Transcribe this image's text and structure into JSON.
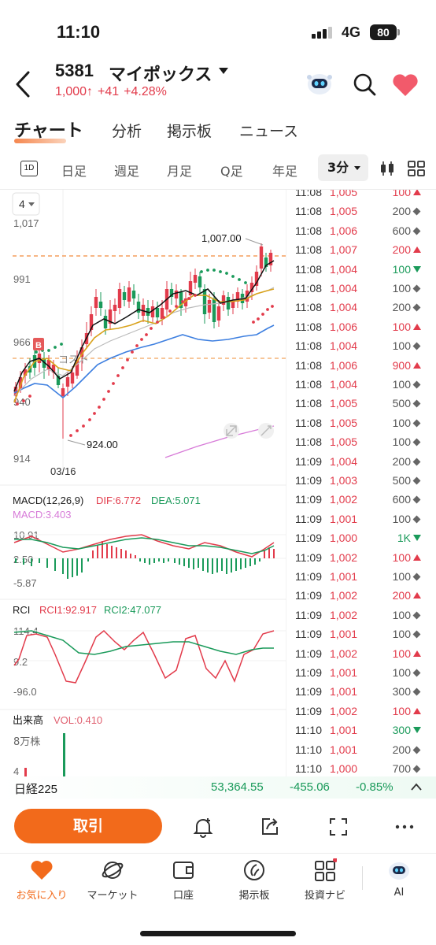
{
  "status_bar": {
    "time": "11:10",
    "network": "4G",
    "battery": "80"
  },
  "header": {
    "stock_code": "5381",
    "stock_name": "マイポックス",
    "price": "1,000",
    "arrow": "↑",
    "change": "+41",
    "change_pct": "+4.28%",
    "icons": [
      "back-icon",
      "ai-robot-icon",
      "search-icon",
      "heart-icon"
    ]
  },
  "tabs": [
    {
      "label": "チャート",
      "active": true
    },
    {
      "label": "分析"
    },
    {
      "label": "掲示板"
    },
    {
      "label": "ニュース"
    }
  ],
  "periods": {
    "icon_1d": "1D",
    "items": [
      "日足",
      "週足",
      "月足",
      "Q足",
      "年足"
    ],
    "active": "3分"
  },
  "chart": {
    "layers_dropdown": "4",
    "price_axis": [
      "1,017",
      "991",
      "966",
      "940",
      "914"
    ],
    "date_label": "03/16",
    "high_label": "1,007.00",
    "low_label": "924.00",
    "buy_marker": "B",
    "cost_label": "コスト",
    "macd": {
      "title": "MACD(12,26,9)",
      "dif": "DIF:6.772",
      "dea": "DEA:5.071",
      "macd": "MACD:3.403",
      "axis": [
        "10.91",
        "2.50",
        "-5.87"
      ]
    },
    "rci": {
      "title": "RCI",
      "rci1": "RCI1:92.917",
      "rci2": "RCI2:47.077",
      "axis": [
        "114.4",
        "9.2",
        "-96.0"
      ]
    },
    "volume": {
      "title": "出来高",
      "vol": "VOL:0.410",
      "axis": [
        "8万株",
        "4"
      ]
    },
    "colors": {
      "up": "#e23b4b",
      "down": "#1a9a5a",
      "ma_short": "#111111",
      "ma_mid": "#d9a21b",
      "ma_long": "#3d7fe0",
      "sar": "#e23b4b",
      "cost_line": "#f28a3c"
    }
  },
  "ticks": [
    {
      "time": "11:08",
      "price": "1,005",
      "vol": "100",
      "dir": "up"
    },
    {
      "time": "11:08",
      "price": "1,005",
      "vol": "200",
      "dir": "flat"
    },
    {
      "time": "11:08",
      "price": "1,006",
      "vol": "600",
      "dir": "flat"
    },
    {
      "time": "11:08",
      "price": "1,007",
      "vol": "200",
      "dir": "up"
    },
    {
      "time": "11:08",
      "price": "1,004",
      "vol": "100",
      "dir": "down"
    },
    {
      "time": "11:08",
      "price": "1,004",
      "vol": "100",
      "dir": "flat"
    },
    {
      "time": "11:08",
      "price": "1,004",
      "vol": "200",
      "dir": "flat"
    },
    {
      "time": "11:08",
      "price": "1,006",
      "vol": "100",
      "dir": "up"
    },
    {
      "time": "11:08",
      "price": "1,004",
      "vol": "100",
      "dir": "flat"
    },
    {
      "time": "11:08",
      "price": "1,006",
      "vol": "900",
      "dir": "up"
    },
    {
      "time": "11:08",
      "price": "1,004",
      "vol": "100",
      "dir": "flat"
    },
    {
      "time": "11:08",
      "price": "1,005",
      "vol": "500",
      "dir": "flat"
    },
    {
      "time": "11:08",
      "price": "1,005",
      "vol": "100",
      "dir": "flat"
    },
    {
      "time": "11:08",
      "price": "1,005",
      "vol": "100",
      "dir": "flat"
    },
    {
      "time": "11:09",
      "price": "1,004",
      "vol": "200",
      "dir": "flat"
    },
    {
      "time": "11:09",
      "price": "1,003",
      "vol": "500",
      "dir": "flat"
    },
    {
      "time": "11:09",
      "price": "1,002",
      "vol": "600",
      "dir": "flat"
    },
    {
      "time": "11:09",
      "price": "1,001",
      "vol": "100",
      "dir": "flat"
    },
    {
      "time": "11:09",
      "price": "1,000",
      "vol": "1K",
      "dir": "down"
    },
    {
      "time": "11:09",
      "price": "1,002",
      "vol": "100",
      "dir": "up"
    },
    {
      "time": "11:09",
      "price": "1,001",
      "vol": "100",
      "dir": "flat"
    },
    {
      "time": "11:09",
      "price": "1,002",
      "vol": "200",
      "dir": "up"
    },
    {
      "time": "11:09",
      "price": "1,002",
      "vol": "100",
      "dir": "flat"
    },
    {
      "time": "11:09",
      "price": "1,001",
      "vol": "100",
      "dir": "flat"
    },
    {
      "time": "11:09",
      "price": "1,002",
      "vol": "100",
      "dir": "up"
    },
    {
      "time": "11:09",
      "price": "1,001",
      "vol": "100",
      "dir": "flat"
    },
    {
      "time": "11:09",
      "price": "1,001",
      "vol": "300",
      "dir": "flat"
    },
    {
      "time": "11:09",
      "price": "1,002",
      "vol": "100",
      "dir": "up"
    },
    {
      "time": "11:10",
      "price": "1,001",
      "vol": "300",
      "dir": "down"
    },
    {
      "time": "11:10",
      "price": "1,001",
      "vol": "200",
      "dir": "flat"
    },
    {
      "time": "11:10",
      "price": "1,000",
      "vol": "700",
      "dir": "flat"
    }
  ],
  "index_bar": {
    "name": "日経225",
    "value": "53,364.55",
    "change": "-455.06",
    "pct": "-0.85%"
  },
  "actions": {
    "trade_label": "取引",
    "icons": [
      "bell-plus-icon",
      "share-icon",
      "fullscreen-icon",
      "more-icon"
    ]
  },
  "bottom_nav": [
    {
      "label": "お気に入り",
      "icon": "heart-icon",
      "active": true
    },
    {
      "label": "マーケット",
      "icon": "planet-icon"
    },
    {
      "label": "口座",
      "icon": "wallet-icon"
    },
    {
      "label": "掲示板",
      "icon": "board-icon"
    },
    {
      "label": "投資ナビ",
      "icon": "grid-icon"
    },
    {
      "label": "AI",
      "icon": "ai-robot-icon"
    }
  ]
}
